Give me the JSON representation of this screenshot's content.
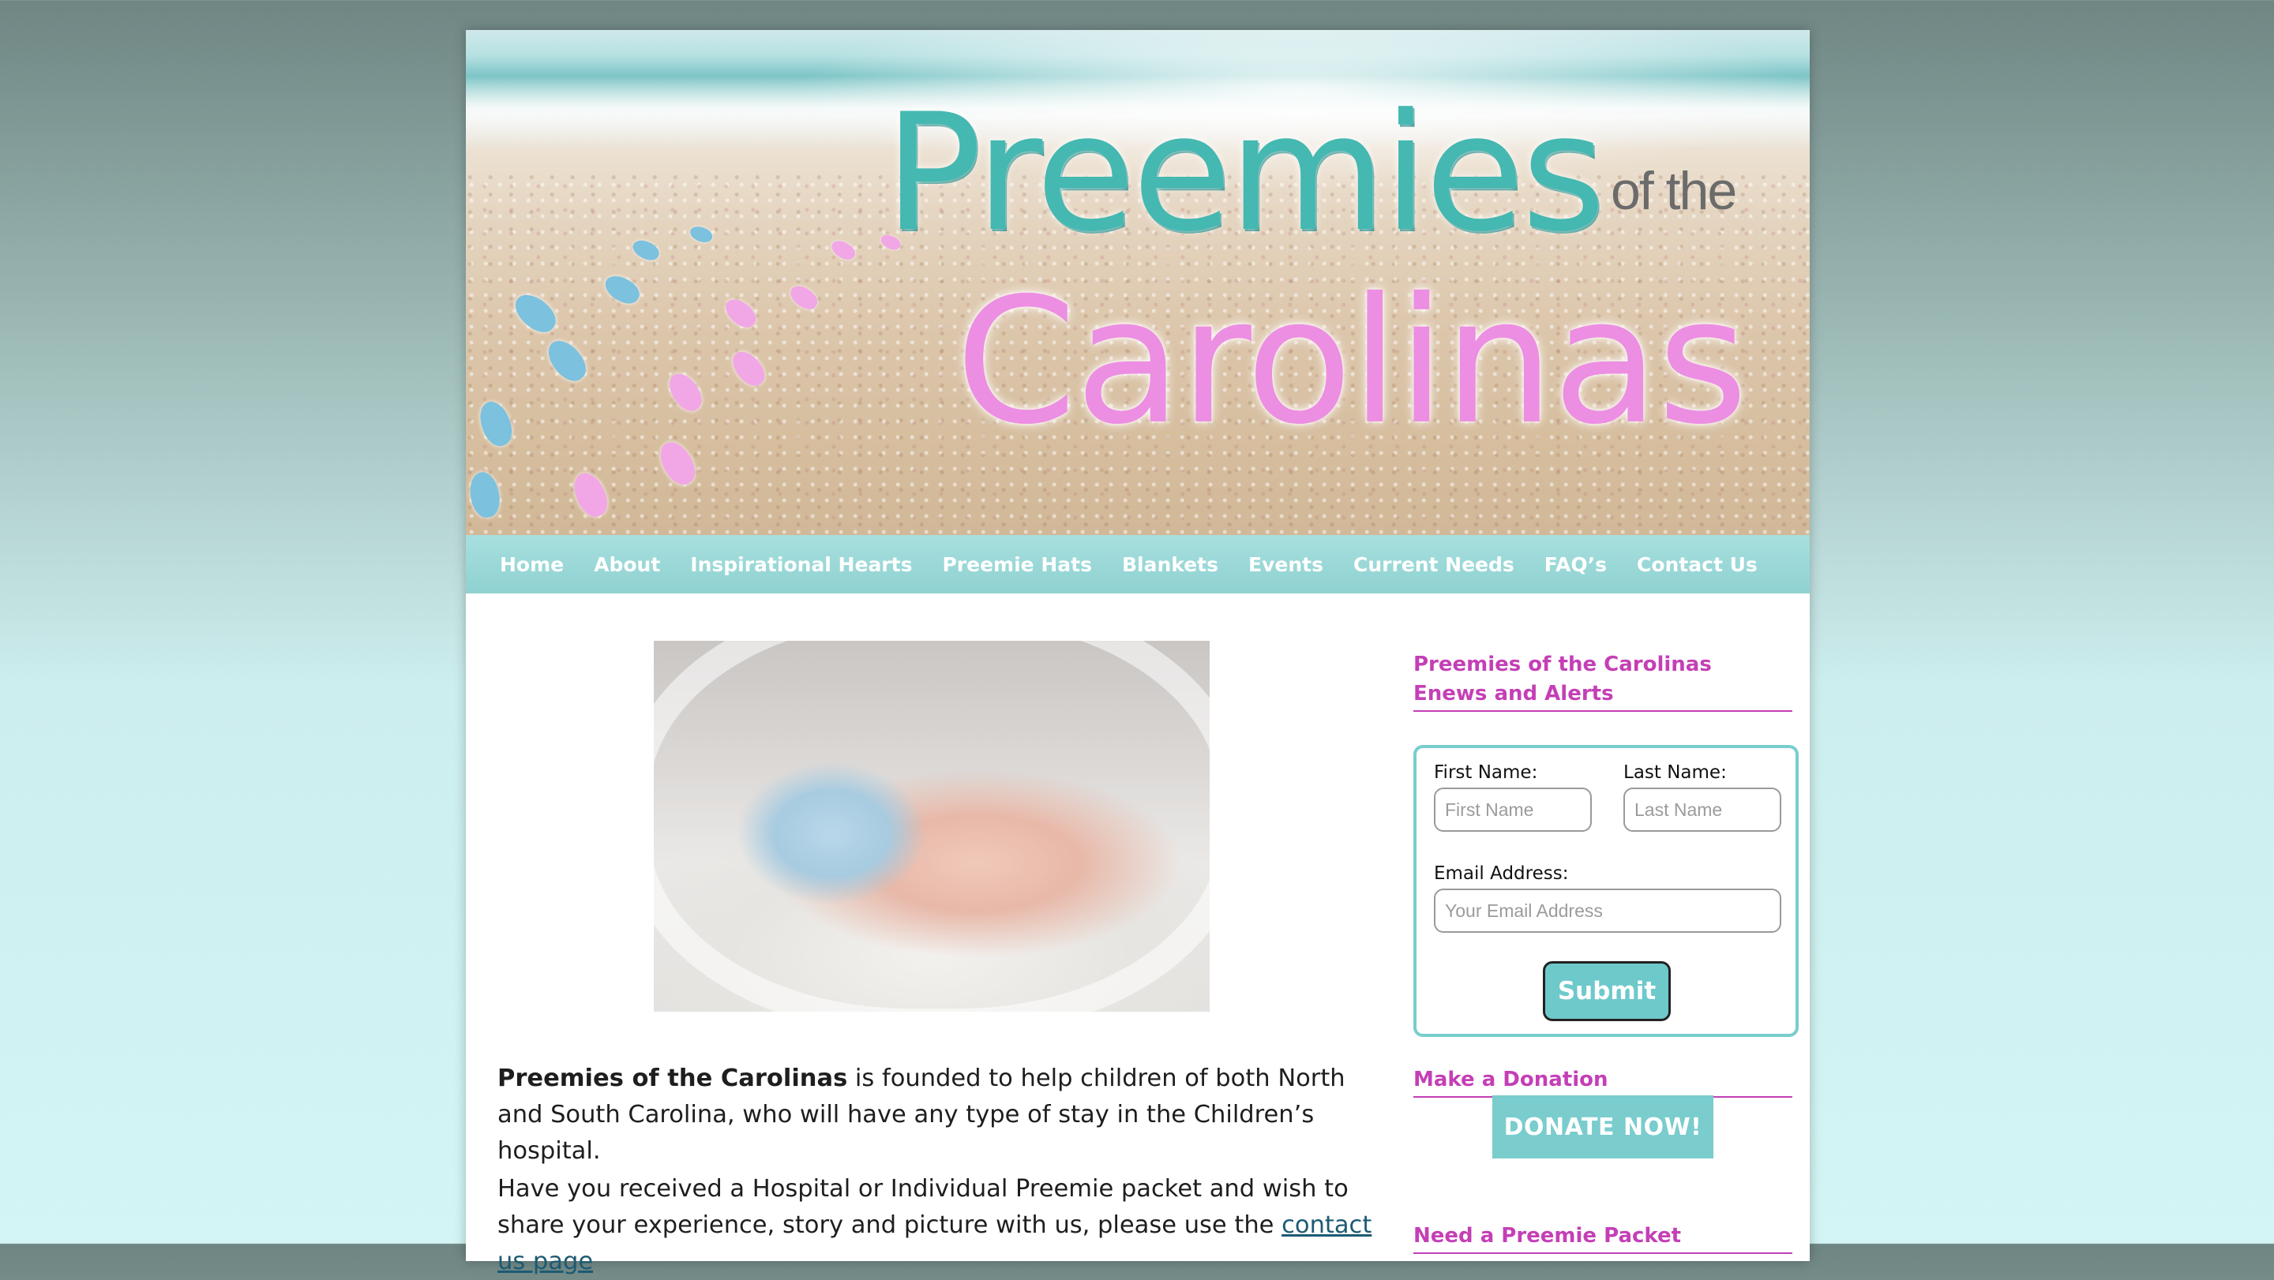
{
  "header": {
    "logo_line1": "Preemies",
    "logo_small": "of the",
    "logo_line2": "Carolinas"
  },
  "nav": {
    "items": [
      "Home",
      "About",
      "Inspirational Hearts",
      "Preemie Hats",
      "Blankets",
      "Events",
      "Current Needs",
      "FAQ’s",
      "Contact Us"
    ]
  },
  "main": {
    "para1_bold": "Preemies of the Carolinas",
    "para1_rest": " is founded to help children of both North and South Carolina, who will have any type of stay in the Children’s hospital.",
    "para2_text": "Have you received a Hospital or Individual Preemie packet and wish to share your experience, story and picture with us, please use the ",
    "para2_link": "contact us page"
  },
  "sidebar": {
    "enews_title": "Preemies of the Carolinas Enews and Alerts",
    "form": {
      "first_label": "First Name:",
      "first_placeholder": "First Name",
      "last_label": "Last Name:",
      "last_placeholder": "Last Name",
      "email_label": "Email Address:",
      "email_placeholder": "Your Email Address",
      "submit_label": "Submit"
    },
    "donation_title": "Make a Donation",
    "donate_button": "DONATE NOW!",
    "packet_title": "Need a Preemie Packet"
  },
  "colors": {
    "accent_pink": "#c43fb6",
    "teal": "#79cdcd",
    "nav_bg": "#8fd2d1"
  }
}
